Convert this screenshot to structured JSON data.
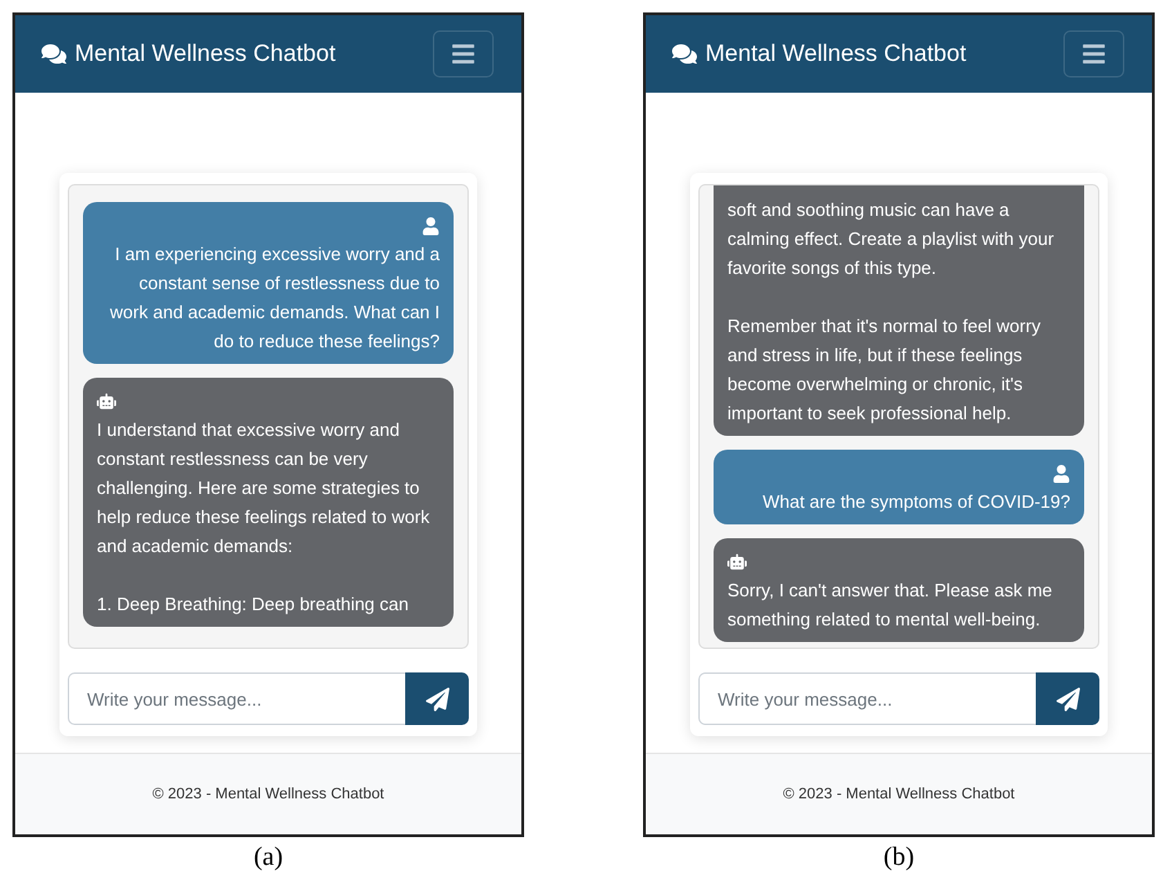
{
  "panels": [
    {
      "caption": "(a)",
      "app": {
        "title": "Mental Wellness Chatbot",
        "messages": [
          {
            "kind": "user",
            "text": "I am experiencing excessive worry and a\nconstant sense of restlessness due to\nwork and academic demands. What can I\ndo to reduce these feelings?"
          },
          {
            "kind": "bot",
            "text": "I understand that excessive worry and\nconstant restlessness can be very\nchallenging. Here are some strategies to\nhelp reduce these feelings related to work\nand academic demands:\n\n1. Deep Breathing: Deep breathing can"
          }
        ],
        "input": {
          "placeholder": "Write your message..."
        },
        "footer": "© 2023 - Mental Wellness Chatbot"
      }
    },
    {
      "caption": "(b)",
      "app": {
        "title": "Mental Wellness Chatbot",
        "messages": [
          {
            "kind": "bot_cont",
            "text": "soft and soothing music can have a\ncalming effect. Create a playlist with your\nfavorite songs of this type.\n\nRemember that it's normal to feel worry\nand stress in life, but if these feelings\nbecome overwhelming or chronic, it's\nimportant to seek professional help."
          },
          {
            "kind": "user",
            "text": "What are the symptoms of COVID-19?"
          },
          {
            "kind": "bot",
            "text": "Sorry, I can't answer that. Please ask me\nsomething related to mental well-being."
          }
        ],
        "input": {
          "placeholder": "Write your message..."
        },
        "footer": "© 2023 - Mental Wellness Chatbot"
      }
    }
  ]
}
